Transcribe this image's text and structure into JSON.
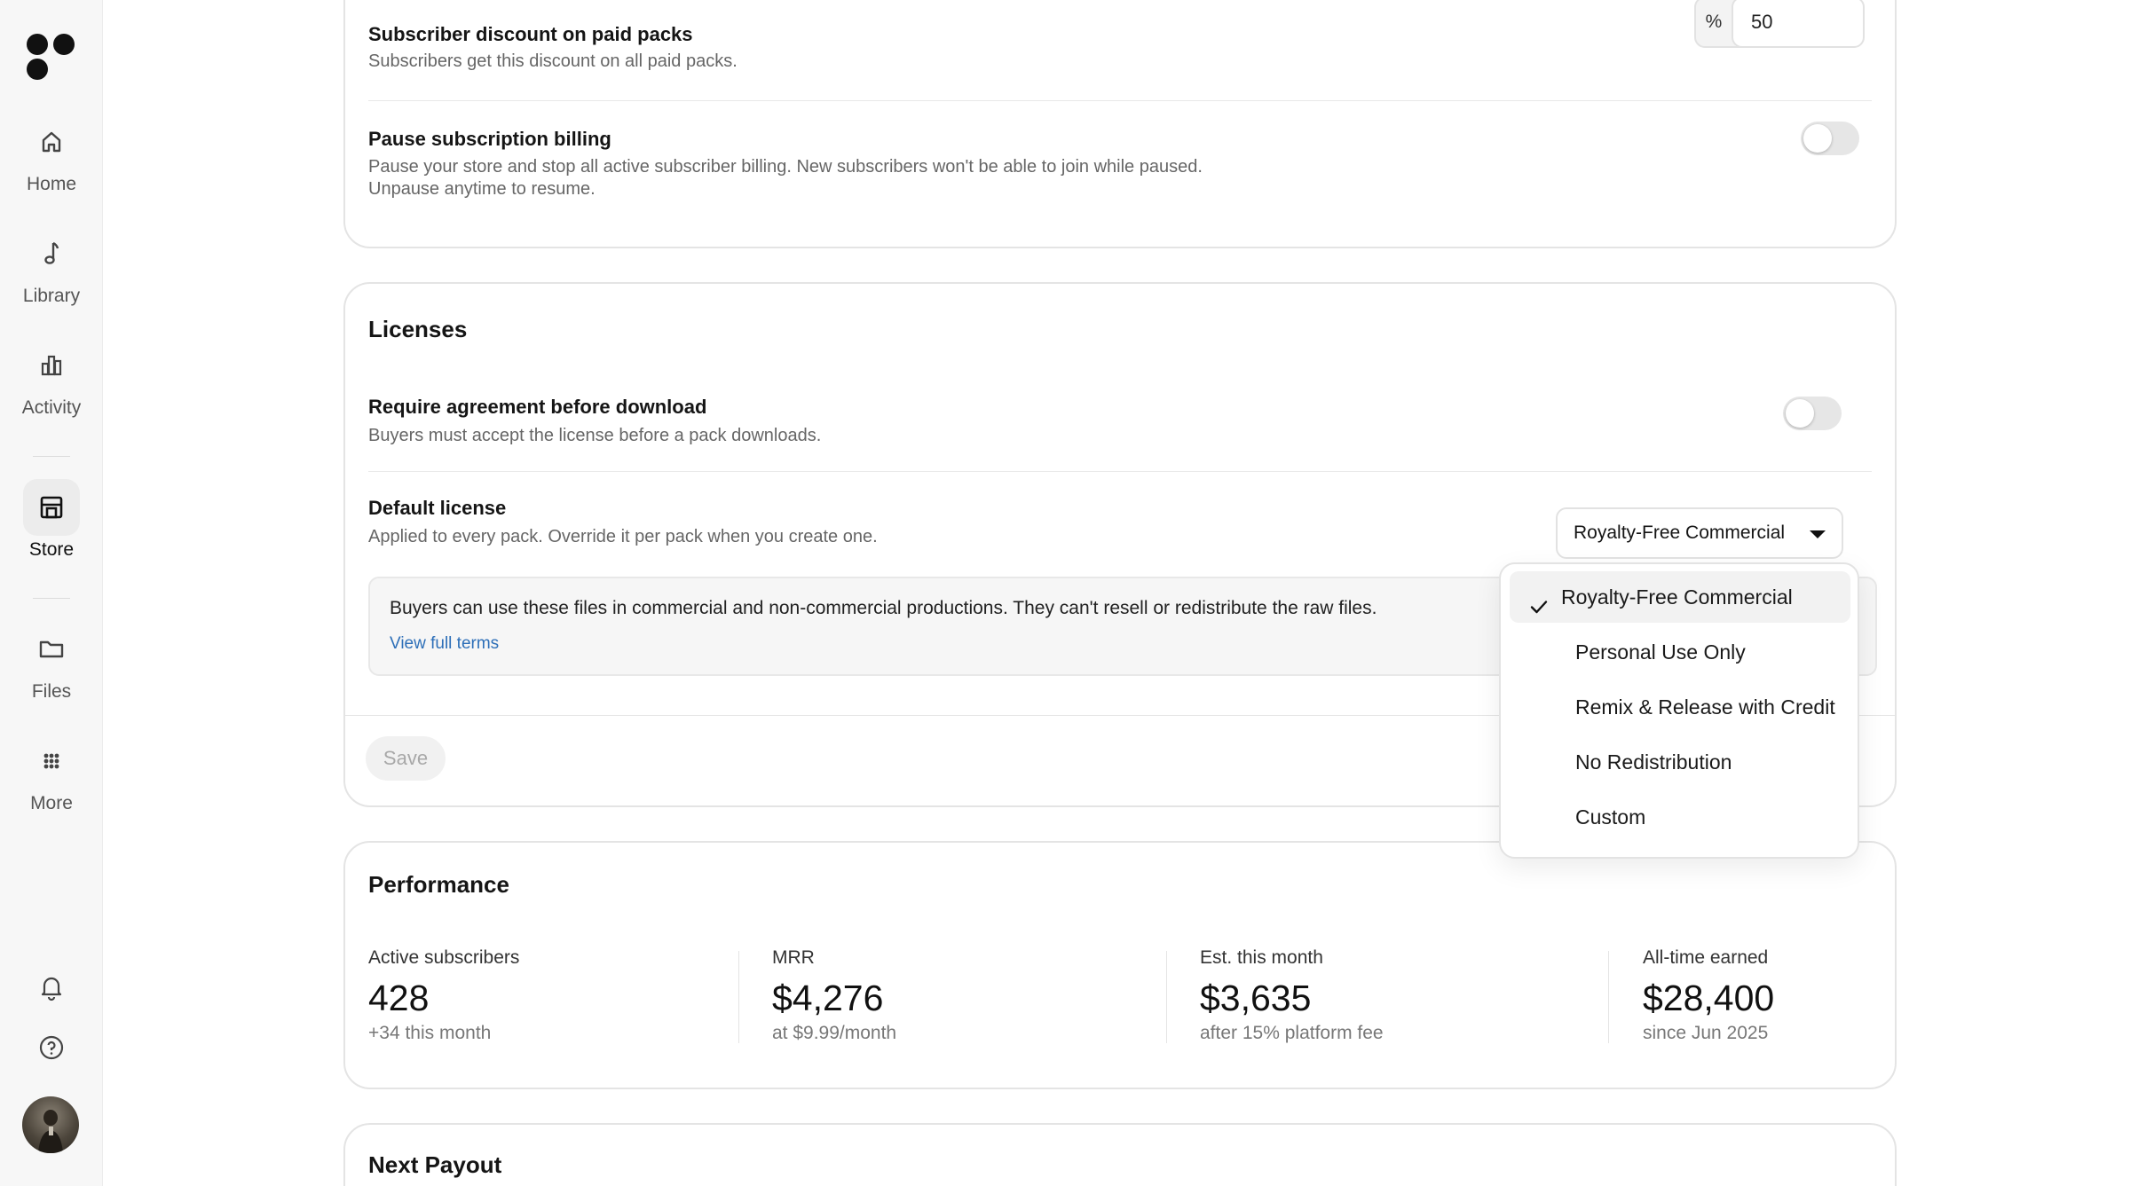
{
  "sidebar": {
    "nav": [
      {
        "label": "Home",
        "icon": "home-icon"
      },
      {
        "label": "Library",
        "icon": "music-note-icon"
      },
      {
        "label": "Activity",
        "icon": "bar-chart-icon"
      },
      {
        "label": "Store",
        "icon": "store-icon"
      },
      {
        "label": "Files",
        "icon": "folder-icon"
      },
      {
        "label": "More",
        "icon": "grid-dots-icon"
      }
    ],
    "active": "Store",
    "bottom_icons": [
      "bell-icon",
      "help-icon"
    ]
  },
  "subscription": {
    "discount_title": "Subscriber discount on paid packs",
    "discount_sub": "Subscribers get this discount on all paid packs.",
    "discount_unit": "%",
    "discount_value": "50",
    "pause_title": "Pause subscription billing",
    "pause_sub_line1": "Pause your store and stop all active subscriber billing. New subscribers won't be able to join while paused.",
    "pause_sub_line2": "Unpause anytime to resume.",
    "pause_on": false
  },
  "licenses": {
    "title": "Licenses",
    "require_title": "Require agreement before download",
    "require_sub": "Buyers must accept the license before a pack downloads.",
    "require_on": false,
    "default_title": "Default license",
    "default_sub": "Applied to every pack. Override it per pack when you create one.",
    "selected": "Royalty-Free Commercial",
    "terms_text": "Buyers can use these files in commercial and non-commercial productions. They can't resell or redistribute the raw files.",
    "terms_link": "View full terms",
    "save_label": "Save",
    "options": [
      "Royalty-Free Commercial",
      "Personal Use Only",
      "Remix & Release with Credit",
      "No Redistribution",
      "Custom"
    ]
  },
  "performance": {
    "title": "Performance",
    "stats": [
      {
        "label": "Active subscribers",
        "value": "428",
        "sub": "+34 this month"
      },
      {
        "label": "MRR",
        "value": "$4,276",
        "sub": "at $9.99/month"
      },
      {
        "label": "Est. this month",
        "value": "$3,635",
        "sub": "after 15% platform fee"
      },
      {
        "label": "All-time earned",
        "value": "$28,400",
        "sub": "since Jun 2025"
      }
    ]
  },
  "payout": {
    "title": "Next Payout"
  },
  "colors": {
    "link": "#2d6fb8",
    "toggle_off": "#e6e6e6",
    "sidebar_bg": "#f7f7f7"
  }
}
